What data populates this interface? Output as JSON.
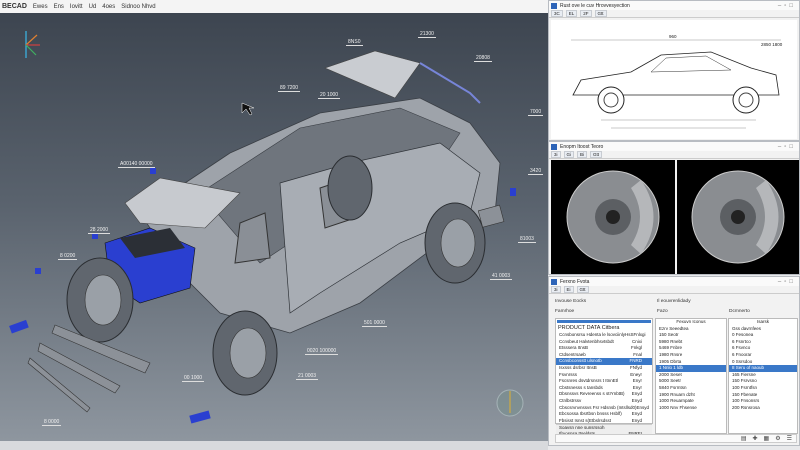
{
  "menubar": {
    "app": "BECAD",
    "items": [
      "Ewes",
      "Ens",
      "Iovitt",
      "Ud",
      "4oes",
      "Sidnoo Nhvd"
    ]
  },
  "viewport": {
    "callouts": [
      "8NS0",
      "21300",
      "20808",
      "89 7200",
      "20 1000",
      "A00140 00000",
      "7000",
      "3420",
      "28 2000",
      "8 0200",
      "81003",
      "41 0003",
      "501 0000",
      "0020 100000",
      "21 0003",
      "00 1000",
      "8 0000"
    ],
    "highlight_color": "#2a3fd0"
  },
  "panel_side": {
    "title": "Rust ove le cuv Hrovvesyection",
    "tools": [
      "3C",
      "EL",
      "2F",
      "Gtt"
    ],
    "dim_top": "960",
    "dim_right": "2850 1800"
  },
  "panel_brake": {
    "title": "Enopm Itoost Teoro",
    "tools": [
      "3i",
      "Gi",
      "Bi",
      "Gtt"
    ]
  },
  "panel_data": {
    "title": "Ferxno Fvota",
    "tools": [
      "3i",
      "Ei",
      "Gtt"
    ],
    "sec_left": "Invouse Eocks",
    "sec_right": "Il eouvrenlidady",
    "col1": "Famrhoe",
    "col2": "Fazo",
    "col3": "Dcmnerto",
    "product_title": "PRODUCT DATA Citbera",
    "left_rows": [
      {
        "name": "Ccnsbonsrsu Hdenta le lsovciinlyHsS",
        "val": "Fnlxgi"
      },
      {
        "name": "Ccnsbeut Halvtenbhsvtsbdt",
        "val": "Cnixi"
      },
      {
        "name": "Etsssera ItnsB",
        "val": "Fnkgl"
      },
      {
        "name": "Ctdsentrsaeb",
        "val": "Fnal"
      },
      {
        "name": "Ccnsbconsstt ulsnotb",
        "val": "FNRD"
      },
      {
        "name": "Isxsss dsrbsr ItnsB",
        "val": "FNfyd"
      },
      {
        "name": "Fsvnrsss",
        "val": "Eneyr"
      },
      {
        "name": "Fscsnres dsvtdrsnsrs t ItnnEtl",
        "val": "Enyr"
      },
      {
        "name": "Cbstsnesss s tansbds",
        "val": "Enyr"
      },
      {
        "name": "Dbsnssvs Revreenss s stIYnbtB)",
        "val": "Enyd"
      },
      {
        "name": "Ctnlbstrssv",
        "val": "Enyd"
      },
      {
        "name": "Cbscsrvnvnssvs Fsr Hdsnsb (Intsllsd0)",
        "val": "Ensyd"
      },
      {
        "name": "Ebcsossa Ibsrtbsn bnsss Hsblf)",
        "val": "Enyd"
      },
      {
        "name": "Fbsisst Isnst s(Etbslrsdsst",
        "val": "Enyd"
      }
    ],
    "left_selected": 4,
    "left_footer1": "Soavsn nne sunsrssoh",
    "left_footer2": "Ifrvosnsa ttseldsts",
    "left_footer2_val": "FNREI",
    "mid_header": "Fexuvn Iconus",
    "mid_rows": [
      "Ezrv Seeedtea",
      "150 Seotr",
      "5980 Rnebt",
      "5469 Fnbre",
      "1980 Rnsre",
      "1905 Dbrta",
      "1 Nnlo 1 ldb",
      "2000 Seset",
      "5000 Seetr",
      "5840 Fsrmtsn",
      "1900 Rnuarn dzht",
      "1000 Reuarnpate",
      "1000 Nnv Fhsense"
    ],
    "mid_selected": 6,
    "right_header": "Isarsk",
    "right_rows": [
      "Gss davrnfees",
      "0 Fesonea",
      "6 Fsnrtco",
      "6 Fsvnco",
      "6 Fnoorar",
      "0 Ssrsdoo",
      "8 Seru of naoub",
      "165 Fiersne",
      "150 Fsrvsno",
      "100 Fsrntfsn",
      "150 Fbenate",
      "100 Fnsonsrs",
      "200 Rsnsrosa"
    ],
    "right_selected": 6,
    "status_icons": [
      "print-icon",
      "plus-icon",
      "grid-icon",
      "settings-icon",
      "layout-icon"
    ]
  }
}
